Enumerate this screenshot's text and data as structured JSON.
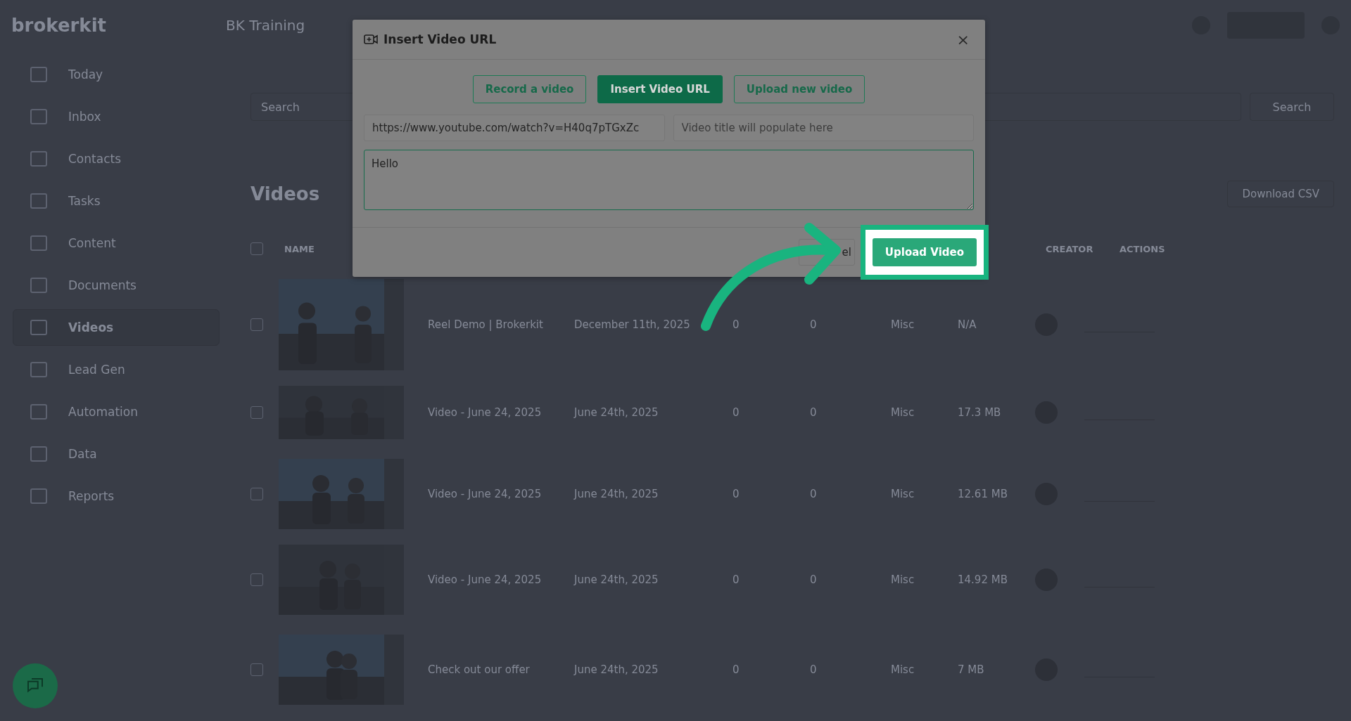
{
  "header": {
    "logo": "brokerkit",
    "workspace": "BK Training"
  },
  "sidebar": {
    "items": [
      {
        "label": "Today",
        "selected": false
      },
      {
        "label": "Inbox",
        "selected": false
      },
      {
        "label": "Contacts",
        "selected": false
      },
      {
        "label": "Tasks",
        "selected": false
      },
      {
        "label": "Content",
        "selected": false
      },
      {
        "label": "Documents",
        "selected": false
      },
      {
        "label": "Videos",
        "selected": true
      },
      {
        "label": "Lead Gen",
        "selected": false
      },
      {
        "label": "Automation",
        "selected": false
      },
      {
        "label": "Data",
        "selected": false
      },
      {
        "label": "Reports",
        "selected": false
      }
    ]
  },
  "main": {
    "search_placeholder": "Search",
    "search_button": "Search",
    "heading": "Videos",
    "download_button": "Download CSV"
  },
  "table": {
    "all_checked": false,
    "columns": [
      "NAME",
      "CREATOR",
      "ACTIONS"
    ],
    "rows": [
      {
        "checked": false,
        "name": "Reel Demo | Brokerkit",
        "date": "December 11th, 2025",
        "column_3": "0",
        "column_4": "0",
        "column_5": "Misc",
        "size": "N/A"
      },
      {
        "checked": false,
        "name": "Video - June 24, 2025",
        "date": "June 24th, 2025",
        "column_3": "0",
        "column_4": "0",
        "column_5": "Misc",
        "size": "17.3 MB"
      },
      {
        "checked": false,
        "name": "Video - June 24, 2025",
        "date": "June 24th, 2025",
        "column_3": "0",
        "column_4": "0",
        "column_5": "Misc",
        "size": "12.61 MB"
      },
      {
        "checked": false,
        "name": "Video - June 24, 2025",
        "date": "June 24th, 2025",
        "column_3": "0",
        "column_4": "0",
        "column_5": "Misc",
        "size": "14.92 MB"
      },
      {
        "checked": false,
        "name": "Check out our offer",
        "date": "June 24th, 2025",
        "column_3": "0",
        "column_4": "0",
        "column_5": "Misc",
        "size": "7 MB"
      }
    ]
  },
  "modal": {
    "title": "Insert Video URL",
    "close": "×",
    "tabs": [
      {
        "label": "Record a video",
        "selected": false
      },
      {
        "label": "Insert Video URL",
        "selected": true
      },
      {
        "label": "Upload new video",
        "selected": false
      }
    ],
    "url_value": "https://www.youtube.com/watch?v=H40q7pTGxZc",
    "title_placeholder": "Video title will populate here",
    "description_value": "Hello",
    "cancel_button": "el",
    "upload_button": "Upload Video"
  }
}
